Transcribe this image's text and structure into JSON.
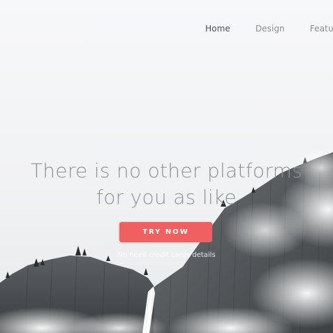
{
  "nav": {
    "items": [
      {
        "label": "Home",
        "active": true
      },
      {
        "label": "Design",
        "active": false
      },
      {
        "label": "Feature",
        "active": false
      }
    ]
  },
  "hero": {
    "headline_line1": "There is no other platforms",
    "headline_line2": "for you as like",
    "cta_label": "TRY NOW",
    "subnote": "No need credit cards details"
  },
  "colors": {
    "accent": "#f06060",
    "headline": "#8e9297",
    "nav_active": "#4a4d52",
    "nav_inactive": "#8a8d91"
  }
}
